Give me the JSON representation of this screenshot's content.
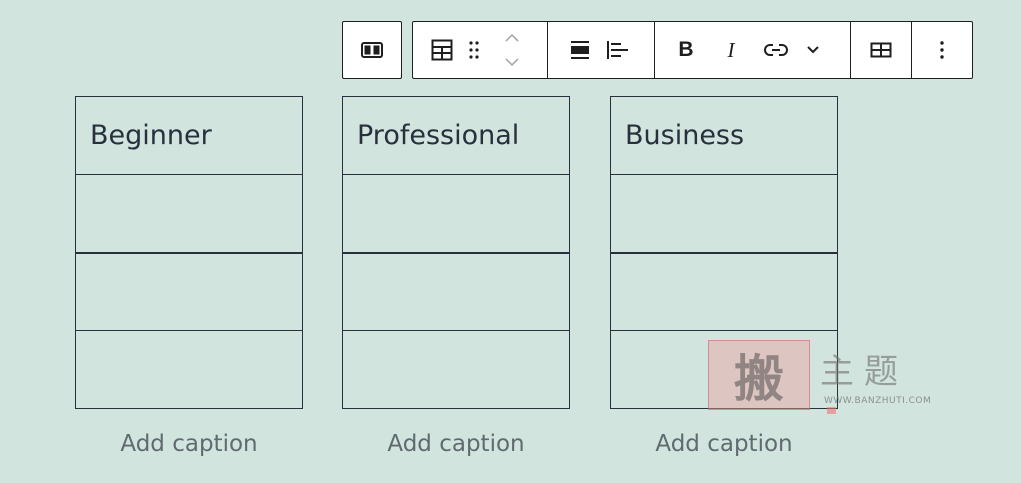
{
  "toolbar": {
    "parent": {
      "icon": "columns-icon"
    },
    "groups": [
      {
        "items": [
          "table-block-icon",
          "drag-handle-icon"
        ],
        "movers": [
          "move-up-icon",
          "move-down-icon"
        ]
      },
      {
        "items": [
          "align-wide-icon",
          "align-left-icon"
        ]
      },
      {
        "items": [
          "bold-icon",
          "italic-icon",
          "link-icon",
          "chevron-down-icon"
        ]
      },
      {
        "items": [
          "edit-table-icon"
        ]
      },
      {
        "items": [
          "more-options-icon"
        ]
      }
    ],
    "bold_label": "B",
    "italic_label": "I"
  },
  "tables": [
    {
      "header": "Beginner",
      "rows": [
        "",
        "",
        ""
      ],
      "caption": "Add caption"
    },
    {
      "header": "Professional",
      "rows": [
        "",
        "",
        ""
      ],
      "caption": "Add caption"
    },
    {
      "header": "Business",
      "rows": [
        "",
        "",
        ""
      ],
      "caption": "Add caption"
    }
  ],
  "watermark": {
    "seal": "搬",
    "chars": "主题",
    "url": "WWW.BANZHUTI.COM"
  },
  "colors": {
    "background": "#d1e4dd",
    "text": "#28303d",
    "caption": "#5f6b6f",
    "toolbar_border": "#1e1e1e"
  }
}
